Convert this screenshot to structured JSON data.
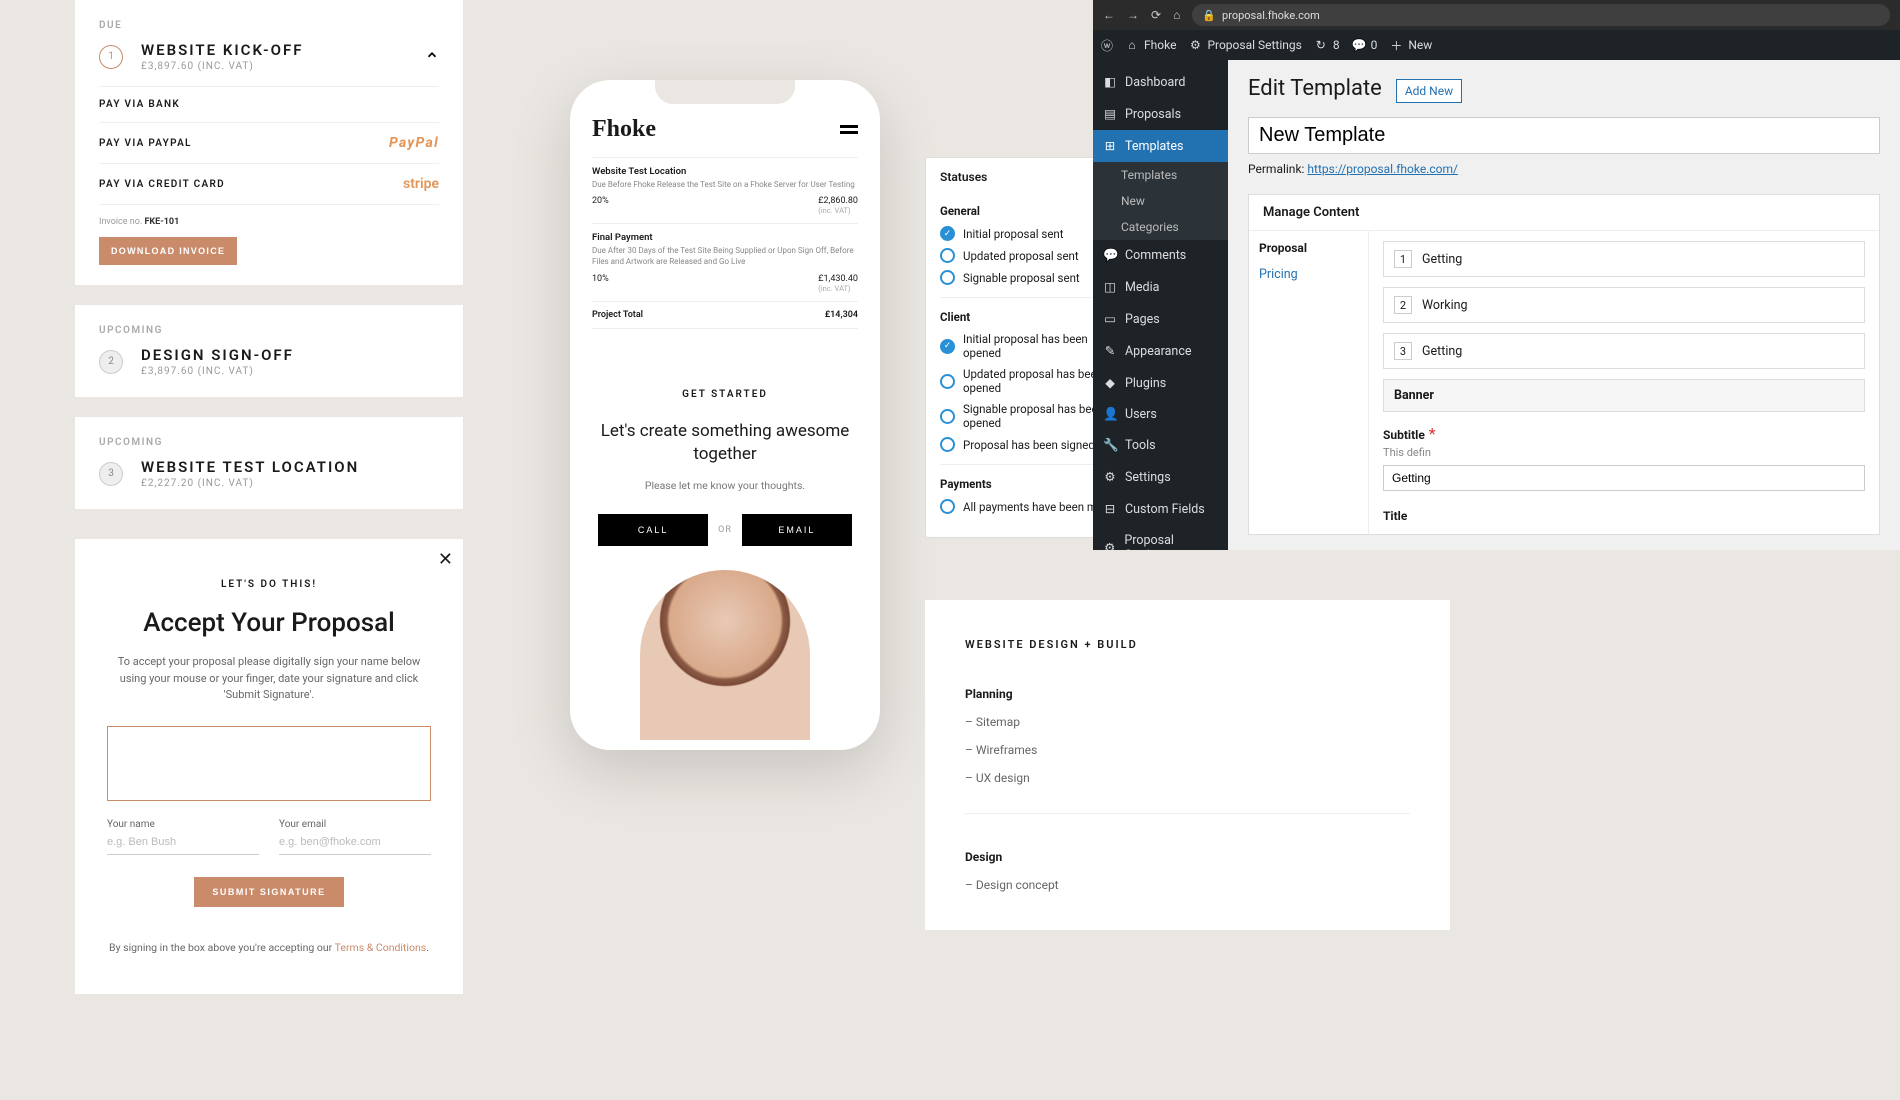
{
  "invoices": {
    "due": {
      "label": "DUE",
      "num": "1",
      "title": "WEBSITE KICK-OFF",
      "subtitle": "£3,897.60 (INC. VAT)",
      "methods": {
        "bank": "PAY VIA BANK",
        "paypal": "PAY VIA PAYPAL",
        "paypal_logo": "PayPal",
        "card": "PAY VIA CREDIT CARD",
        "stripe_logo": "stripe"
      },
      "invoice_no_label": "Invoice no.",
      "invoice_no": "FKE-101",
      "download": "DOWNLOAD INVOICE"
    },
    "upcoming1": {
      "label": "UPCOMING",
      "num": "2",
      "title": "DESIGN SIGN-OFF",
      "subtitle": "£3,897.60 (INC. VAT)"
    },
    "upcoming2": {
      "label": "UPCOMING",
      "num": "3",
      "title": "WEBSITE TEST LOCATION",
      "subtitle": "£2,227.20 (INC. VAT)"
    }
  },
  "modal": {
    "eyebrow": "LET'S DO THIS!",
    "title": "Accept Your Proposal",
    "desc": "To accept your proposal please digitally sign your name below using your mouse or your finger, date your signature and click 'Submit Signature'.",
    "name_label": "Your name",
    "name_ph": "e.g. Ben Bush",
    "email_label": "Your email",
    "email_ph": "e.g. ben@fhoke.com",
    "submit": "SUBMIT SIGNATURE",
    "terms_pre": "By signing in the box above you're accepting our ",
    "terms_link": "Terms & Conditions"
  },
  "phone": {
    "logo": "Fhoke",
    "sec1": {
      "title": "Website Test Location",
      "sub": "Due Before Fhoke Release the Test Site on a Fhoke Server for User Testing",
      "pct": "20%",
      "amt": "£2,860.80",
      "amt_sub": "(inc. VAT)"
    },
    "sec2": {
      "title": "Final Payment",
      "sub": "Due After 30 Days of the Test Site Being Supplied or Upon Sign Off, Before Files and Artwork are Released and Go Live",
      "pct": "10%",
      "amt": "£1,430.40",
      "amt_sub": "(inc. VAT)"
    },
    "total_label": "Project Total",
    "total_amt": "£14,304",
    "gs_eyebrow": "GET STARTED",
    "gs_title": "Let's create something awesome together",
    "gs_sub": "Please let me know your thoughts.",
    "call": "CALL",
    "or": "OR",
    "email": "EMAIL"
  },
  "statuses": {
    "title": "Statuses",
    "general": "General",
    "g1": "Initial proposal sent",
    "g2": "Updated proposal sent",
    "g3": "Signable proposal sent",
    "client": "Client",
    "c1": "Initial proposal has been opened",
    "c2": "Updated proposal has been opened",
    "c3": "Signable proposal has been opened",
    "c4": "Proposal has been signed",
    "payments": "Payments",
    "p1": "All payments have been made"
  },
  "wp": {
    "url": "proposal.fhoke.com",
    "site": "Fhoke",
    "prop_settings": "Proposal Settings",
    "updates": "8",
    "comments": "0",
    "new": "New",
    "menu": {
      "dashboard": "Dashboard",
      "proposals": "Proposals",
      "templates": "Templates",
      "sub_templates": "Templates",
      "sub_new": "New",
      "sub_categories": "Categories",
      "comments": "Comments",
      "media": "Media",
      "pages": "Pages",
      "appearance": "Appearance",
      "plugins": "Plugins",
      "users": "Users",
      "tools": "Tools",
      "settings": "Settings",
      "custom_fields": "Custom Fields",
      "prop_settings": "Proposal Settings"
    },
    "h1": "Edit Template",
    "addnew": "Add New",
    "title_val": "New Template",
    "permalink_label": "Permalink:",
    "permalink_url": "https://proposal.fhoke.com/",
    "panel_h": "Manage Content",
    "side_h": "Proposal",
    "side_link": "Pricing",
    "steps": {
      "s1": "Getting",
      "s2": "Working",
      "s3": "Getting"
    },
    "banner": "Banner",
    "subtitle_label": "Subtitle",
    "subtitle_desc": "This defin",
    "subtitle_val": "Getting",
    "title_label": "Title"
  },
  "wdb": {
    "eyebrow": "WEBSITE DESIGN + BUILD",
    "planning": "Planning",
    "p1": "– Sitemap",
    "p2": "– Wireframes",
    "p3": "– UX design",
    "design": "Design",
    "d1": "– Design concept"
  }
}
